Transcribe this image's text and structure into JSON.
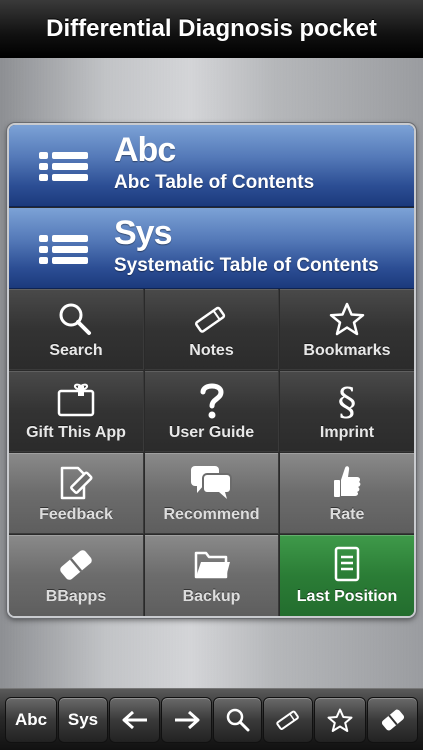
{
  "header": {
    "title": "Differential Diagnosis pocket"
  },
  "toc": [
    {
      "big": "Abc",
      "sub": "Abc Table of Contents"
    },
    {
      "big": "Sys",
      "sub": "Systematic Table of Contents"
    }
  ],
  "grid": [
    {
      "label": "Search",
      "icon": "search-icon"
    },
    {
      "label": "Notes",
      "icon": "pencil-icon"
    },
    {
      "label": "Bookmarks",
      "icon": "star-icon"
    },
    {
      "label": "Gift This App",
      "icon": "gift-icon"
    },
    {
      "label": "User Guide",
      "icon": "question-icon"
    },
    {
      "label": "Imprint",
      "icon": "section-icon"
    },
    {
      "label": "Feedback",
      "icon": "feedback-icon"
    },
    {
      "label": "Recommend",
      "icon": "chat-bubbles-icon"
    },
    {
      "label": "Rate",
      "icon": "thumbs-up-icon"
    },
    {
      "label": "BBapps",
      "icon": "bbapps-icon"
    },
    {
      "label": "Backup",
      "icon": "folder-icon"
    },
    {
      "label": "Last Position",
      "icon": "document-icon"
    }
  ],
  "toolbar": {
    "abc": "Abc",
    "sys": "Sys",
    "icons": [
      "arrow-left-icon",
      "arrow-right-icon",
      "search-icon",
      "pencil-icon",
      "star-icon",
      "bbapps-icon"
    ]
  },
  "colors": {
    "toc_blue": "#2c4e94",
    "last_position_green": "#2b7d36"
  }
}
